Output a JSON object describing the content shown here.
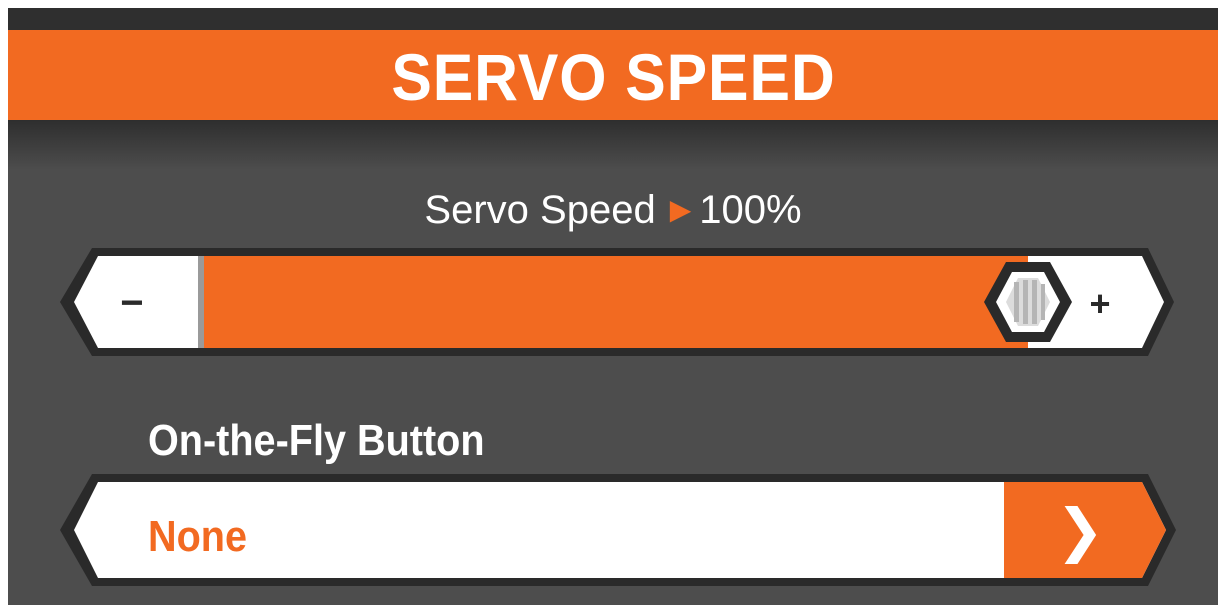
{
  "header": {
    "title": "SERVO SPEED"
  },
  "servo_speed": {
    "label": "Servo Speed",
    "value_text": "100%",
    "value_percent": 100,
    "decrease_symbol": "−",
    "increase_symbol": "+"
  },
  "on_the_fly": {
    "label": "On-the-Fly Button",
    "selected_value": "None",
    "open_icon": "chevron-right-icon"
  },
  "colors": {
    "accent": "#f26a21",
    "background": "#4d4d4d",
    "header_band": "#2f2f2f",
    "text": "#ffffff"
  }
}
